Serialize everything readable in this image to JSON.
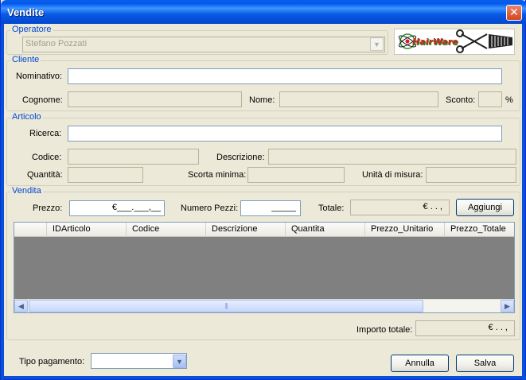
{
  "window": {
    "title": "Vendite",
    "close_symbol": "✕"
  },
  "operatore": {
    "legend": "Operatore",
    "value": "Stefano Pozzati"
  },
  "logo": {
    "text": "HairWare"
  },
  "cliente": {
    "legend": "Cliente",
    "nominativo_label": "Nominativo:",
    "cognome_label": "Cognome:",
    "nome_label": "Nome:",
    "sconto_label": "Sconto:",
    "percent": "%"
  },
  "articolo": {
    "legend": "Articolo",
    "ricerca_label": "Ricerca:",
    "codice_label": "Codice:",
    "descrizione_label": "Descrizione:",
    "quantita_label": "Quantità:",
    "scorta_label": "Scorta minima:",
    "unita_label": "Unità di misura:"
  },
  "vendita": {
    "legend": "Vendita",
    "prezzo_label": "Prezzo:",
    "prezzo_mask": "€___.___,__",
    "pezzi_label": "Numero Pezzi:",
    "pezzi_mask": "_____",
    "totale_label": "Totale:",
    "totale_mask": "€   .   .   ,",
    "aggiungi": "Aggiungi",
    "columns": [
      "IDArticolo",
      "Codice",
      "Descrizione",
      "Quantita",
      "Prezzo_Unitario",
      "Prezzo_Totale"
    ],
    "scroll_grip": "|||",
    "importo_label": "Importo totale:",
    "importo_mask": "€   .   .   ,"
  },
  "footer": {
    "tipo_pagamento_label": "Tipo pagamento:",
    "tipo_pagamento_value": "",
    "annulla": "Annulla",
    "salva": "Salva"
  },
  "colors": {
    "title_blue": "#0058ee",
    "legend_blue": "#0046d5",
    "grid_bg": "#808080"
  }
}
